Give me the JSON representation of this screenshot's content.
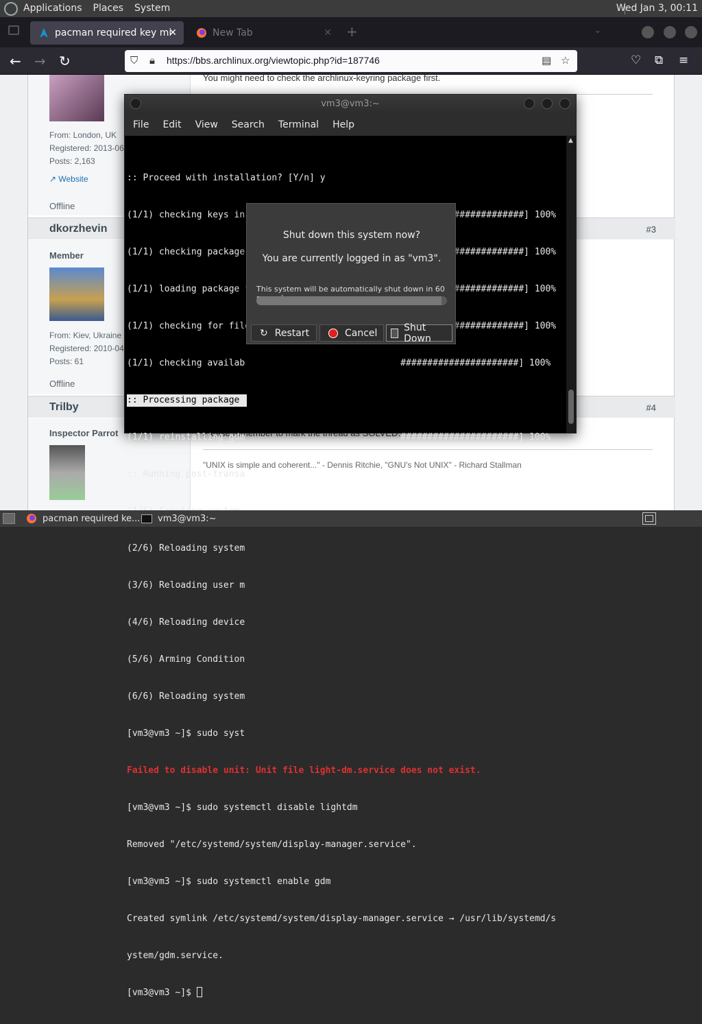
{
  "top_panel": {
    "menus": [
      "Applications",
      "Places",
      "System"
    ],
    "clock": "Wed Jan  3, 00:11"
  },
  "browser": {
    "tabs": [
      {
        "label": "pacman required key missin",
        "active": true
      },
      {
        "label": "New Tab",
        "active": false
      }
    ],
    "url": "https://bbs.archlinux.org/viewtopic.php?id=187746"
  },
  "forum": {
    "post1": {
      "text": "You might need to check the archlinux-keyring package first.",
      "from": "From: London, UK",
      "registered": "Registered: 2013-06",
      "posts": "Posts: 2,163",
      "website": "Website",
      "status": "Offline"
    },
    "post2": {
      "user": "dkorzhevin",
      "num": "#3",
      "rank": "Member",
      "from": "From: Kiev, Ukraine",
      "registered": "Registered: 2010-04",
      "posts": "Posts: 61",
      "status": "Offline"
    },
    "post3": {
      "user": "Trilby",
      "num": "#4",
      "rank": "Inspector Parrot",
      "text": "Please remember to mark the thread as SOLVED.",
      "quote": "\"UNIX is simple and coherent...\" - Dennis Ritchie, \"GNU's Not UNIX\" -  Richard Stallman"
    }
  },
  "terminal": {
    "title": "vm3@vm3:~",
    "menu": [
      "File",
      "Edit",
      "View",
      "Search",
      "Terminal",
      "Help"
    ],
    "lines": [
      ":: Proceed with installation? [Y/n] y",
      "(1/1) checking keys in keyring                     [######################] 100%",
      "(1/1) checking package integrity                   [######################] 100%",
      "(1/1) loading package files                        [######################] 100%",
      "(1/1) checking for file conflicts                  [######################] 100%",
      "(1/1) checking availab                             ######################] 100%",
      ":: Processing package ",
      "(1/1) reinstalling gdm                             ######################] 100%",
      ":: Running post-transa",
      "(1/6) Creating system ",
      "(2/6) Reloading system",
      "(3/6) Reloading user m",
      "(4/6) Reloading device",
      "(5/6) Arming Condition",
      "(6/6) Reloading system",
      "[vm3@vm3 ~]$ sudo syst",
      "Failed to disable unit: Unit file light-dm.service does not exist.",
      "[vm3@vm3 ~]$ sudo systemctl disable lightdm",
      "Removed \"/etc/systemd/system/display-manager.service\".",
      "[vm3@vm3 ~]$ sudo systemctl enable gdm",
      "Created symlink /etc/systemd/system/display-manager.service → /usr/lib/systemd/s",
      "ystem/gdm.service.",
      "[vm3@vm3 ~]$ "
    ]
  },
  "dialog": {
    "question": "Shut down this system now?",
    "logged_in": "You are currently logged in as \"vm3\".",
    "auto_msg": "This system will be automatically shut down in 60 seconds",
    "progress": 0.97,
    "buttons": {
      "restart": "Restart",
      "cancel": "Cancel",
      "shutdown": "Shut Down"
    },
    "colors": {
      "cancel_icon": "#e02020"
    }
  },
  "taskbar": {
    "items": [
      "pacman required ke...",
      "vm3@vm3:~"
    ]
  }
}
